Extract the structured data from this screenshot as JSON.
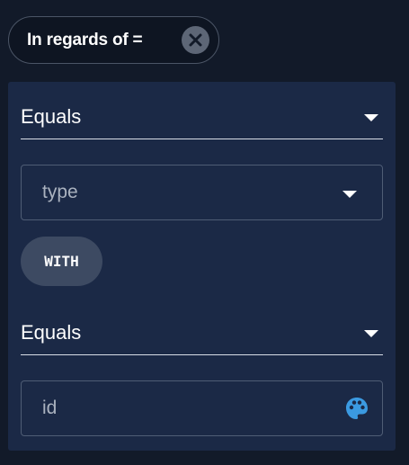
{
  "filter_chip": {
    "label": "In regards of =",
    "close_icon": "close-circle-icon"
  },
  "filter_panel": {
    "operator_1": {
      "value": "Equals",
      "icon": "caret-down-icon"
    },
    "field_select": {
      "value": "type",
      "icon": "caret-down-icon"
    },
    "connector_chip": {
      "label": "WITH"
    },
    "operator_2": {
      "value": "Equals",
      "icon": "caret-down-icon"
    },
    "value_input": {
      "value": "id",
      "icon": "palette-icon",
      "icon_color": "#3b9ae1"
    }
  },
  "colors": {
    "background": "#121a29",
    "panel": "#1b2946",
    "chip_button": "#3d4a62",
    "accent": "#3b9ae1"
  }
}
